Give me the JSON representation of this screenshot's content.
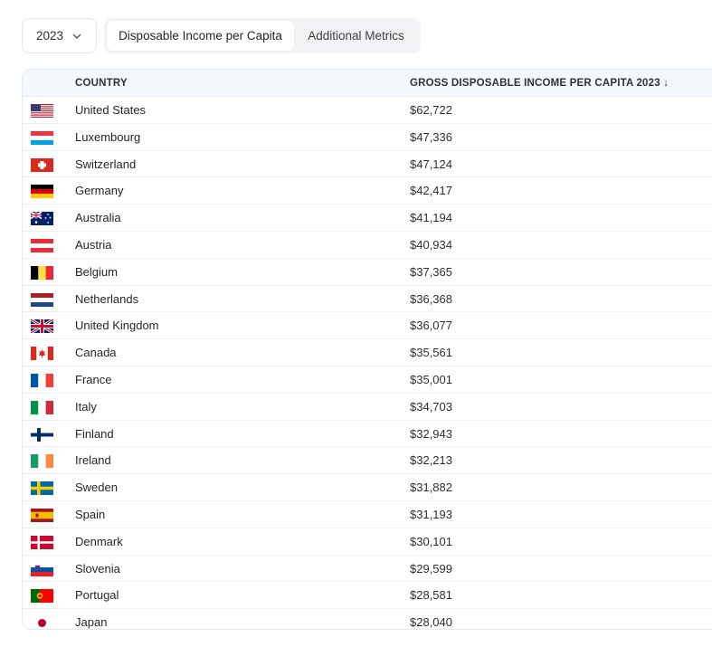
{
  "year_select": {
    "value": "2023"
  },
  "tabs": [
    {
      "label": "Disposable Income per Capita",
      "active": true
    },
    {
      "label": "Additional Metrics",
      "active": false
    }
  ],
  "table": {
    "columns": {
      "country": "COUNTRY",
      "income": "GROSS DISPOSABLE INCOME PER CAPITA 2023 ↓"
    },
    "rows": [
      {
        "country": "United States",
        "value": "$62,722",
        "flag": "us-flag-icon"
      },
      {
        "country": "Luxembourg",
        "value": "$47,336",
        "flag": "luxembourg-flag-icon"
      },
      {
        "country": "Switzerland",
        "value": "$47,124",
        "flag": "switzerland-flag-icon"
      },
      {
        "country": "Germany",
        "value": "$42,417",
        "flag": "germany-flag-icon"
      },
      {
        "country": "Australia",
        "value": "$41,194",
        "flag": "australia-flag-icon"
      },
      {
        "country": "Austria",
        "value": "$40,934",
        "flag": "austria-flag-icon"
      },
      {
        "country": "Belgium",
        "value": "$37,365",
        "flag": "belgium-flag-icon"
      },
      {
        "country": "Netherlands",
        "value": "$36,368",
        "flag": "netherlands-flag-icon"
      },
      {
        "country": "United Kingdom",
        "value": "$36,077",
        "flag": "uk-flag-icon"
      },
      {
        "country": "Canada",
        "value": "$35,561",
        "flag": "canada-flag-icon"
      },
      {
        "country": "France",
        "value": "$35,001",
        "flag": "france-flag-icon"
      },
      {
        "country": "Italy",
        "value": "$34,703",
        "flag": "italy-flag-icon"
      },
      {
        "country": "Finland",
        "value": "$32,943",
        "flag": "finland-flag-icon"
      },
      {
        "country": "Ireland",
        "value": "$32,213",
        "flag": "ireland-flag-icon"
      },
      {
        "country": "Sweden",
        "value": "$31,882",
        "flag": "sweden-flag-icon"
      },
      {
        "country": "Spain",
        "value": "$31,193",
        "flag": "spain-flag-icon"
      },
      {
        "country": "Denmark",
        "value": "$30,101",
        "flag": "denmark-flag-icon"
      },
      {
        "country": "Slovenia",
        "value": "$29,599",
        "flag": "slovenia-flag-icon"
      },
      {
        "country": "Portugal",
        "value": "$28,581",
        "flag": "portugal-flag-icon"
      },
      {
        "country": "Japan",
        "value": "$28,040",
        "flag": "japan-flag-icon"
      }
    ]
  },
  "colors": {
    "header_bg": "#f2f8fc",
    "tab_track_bg": "#f1f3f5",
    "border": "#e6e9ed"
  }
}
